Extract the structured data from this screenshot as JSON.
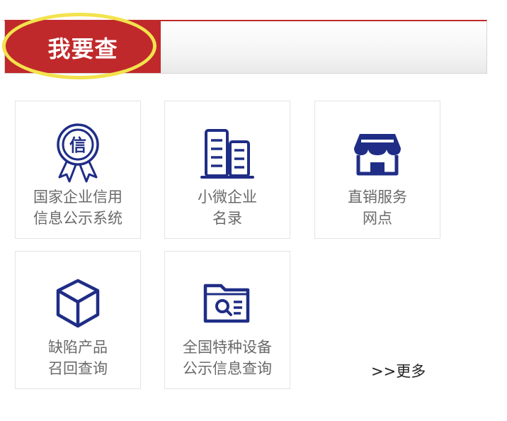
{
  "header": {
    "title": "我要查"
  },
  "colors": {
    "accent_red": "#c0292b",
    "icon_blue": "#1f2d86",
    "highlight": "#f2e34c"
  },
  "tiles": [
    {
      "icon": "certificate-badge-icon",
      "badge_char": "信",
      "line1": "国家企业信用",
      "line2": "信息公示系统"
    },
    {
      "icon": "buildings-icon",
      "line1": "小微企业",
      "line2": "名录"
    },
    {
      "icon": "storefront-icon",
      "line1": "直销服务",
      "line2": "网点"
    },
    {
      "icon": "box-cube-icon",
      "line1": "缺陷产品",
      "line2": "召回查询"
    },
    {
      "icon": "folder-search-icon",
      "line1": "全国特种设备",
      "line2": "公示信息查询"
    }
  ],
  "more": {
    "label": ">>更多"
  }
}
